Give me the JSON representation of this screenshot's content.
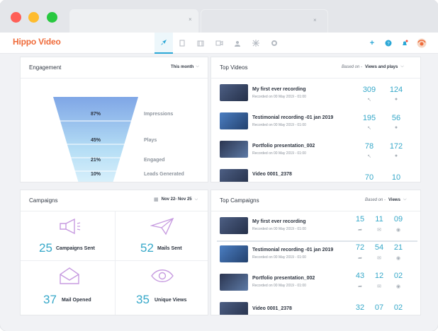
{
  "app": {
    "logo": "Hippo Video"
  },
  "browser": {
    "tab1_close": "×",
    "tab2_close": "×"
  },
  "nav": {
    "icons": [
      "rocket-icon",
      "document-icon",
      "film-icon",
      "video-camera-icon",
      "users-icon",
      "puzzle-icon",
      "gear-icon"
    ],
    "active_index": 0,
    "right_icons": [
      "plus-icon",
      "help-icon",
      "bell-icon",
      "avatar"
    ]
  },
  "engagement": {
    "title": "Engagement",
    "filter": "This month",
    "funnel": [
      {
        "pct": "87%",
        "label": "Impressions"
      },
      {
        "pct": "45%",
        "label": "Plays"
      },
      {
        "pct": "21%",
        "label": "Engaged"
      },
      {
        "pct": "10%",
        "label": "Leads Generated"
      }
    ]
  },
  "top_videos": {
    "title": "Top Videos",
    "based_on_label": "Based on -",
    "based_on_value": "Views and plays",
    "rows": [
      {
        "title": "My first ever recording",
        "sub": "Recorded on 00 May 2019 - 01:00",
        "a": "309",
        "b": "124"
      },
      {
        "title": "Testimonial recording -01 jan 2019",
        "sub": "Recorded on 00 May 2019 - 01:00",
        "a": "195",
        "b": "56"
      },
      {
        "title": "Portfolio presentation_002",
        "sub": "Recorded on 00 May 2019 - 01:00",
        "a": "78",
        "b": "172"
      },
      {
        "title": "Video 0001_2378",
        "sub": "",
        "a": "70",
        "b": "10"
      }
    ]
  },
  "campaigns": {
    "title": "Campaigns",
    "date_range": "Nov 22- Nov 25",
    "cards": [
      {
        "num": "25",
        "label": "Campaigns Sent"
      },
      {
        "num": "52",
        "label": "Mails Sent"
      },
      {
        "num": "37",
        "label": "Mail Opened"
      },
      {
        "num": "35",
        "label": "Unique Views"
      }
    ]
  },
  "top_campaigns": {
    "title": "Top Campaigns",
    "based_on_label": "Based on -",
    "based_on_value": "Views",
    "rows": [
      {
        "title": "My first ever recording",
        "sub": "Recorded on 00 May 2019 - 01:00",
        "a": "15",
        "b": "11",
        "c": "09"
      },
      {
        "title": "Testimonial recording -01 jan 2019",
        "sub": "Recorded on 00 May 2019 - 01:00",
        "a": "72",
        "b": "54",
        "c": "21"
      },
      {
        "title": "Portfolio presentation_002",
        "sub": "Recorded on 00 May 2019 - 01:00",
        "a": "43",
        "b": "12",
        "c": "02"
      },
      {
        "title": "Video 0001_2378",
        "sub": "",
        "a": "32",
        "b": "07",
        "c": "02"
      }
    ]
  },
  "colors": {
    "accent": "#36a8c9",
    "brand": "#ef6b3a"
  }
}
